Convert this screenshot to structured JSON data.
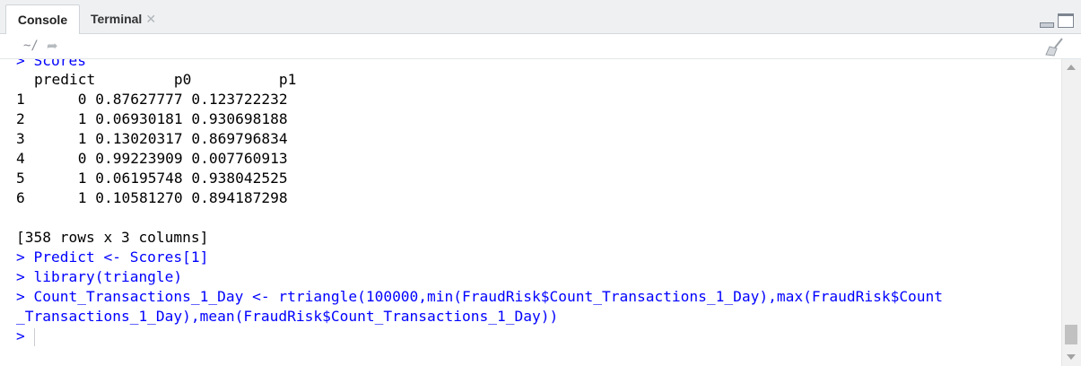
{
  "tabs": {
    "console": "Console",
    "terminal": "Terminal",
    "close": "✕"
  },
  "subbar": {
    "path": "~/",
    "goto_icon": "arrow-icon",
    "clear_icon": "broom-icon"
  },
  "console": {
    "scrolled_prompt": "> Scores",
    "header": "predict         p0          p1",
    "rows": [
      {
        "index": "1",
        "rest": "     0 0.87627777 0.123722232"
      },
      {
        "index": "2",
        "rest": "     1 0.06930181 0.930698188"
      },
      {
        "index": "3",
        "rest": "     1 0.13020317 0.869796834"
      },
      {
        "index": "4",
        "rest": "     0 0.99223909 0.007760913"
      },
      {
        "index": "5",
        "rest": "     1 0.06195748 0.938042525"
      },
      {
        "index": "6",
        "rest": "     1 0.10581270 0.894187298"
      }
    ],
    "summary": "[358 rows x 3 columns]",
    "commands": [
      "> Predict <- Scores[1]",
      "> library(triangle)",
      "> Count_Transactions_1_Day <- rtriangle(100000,min(FraudRisk$Count_Transactions_1_Day),max(FraudRisk$Count",
      "_Transactions_1_Day),mean(FraudRisk$Count_Transactions_1_Day))"
    ],
    "prompt": ">"
  },
  "colors": {
    "command": "#0000ff",
    "output": "#000000"
  }
}
